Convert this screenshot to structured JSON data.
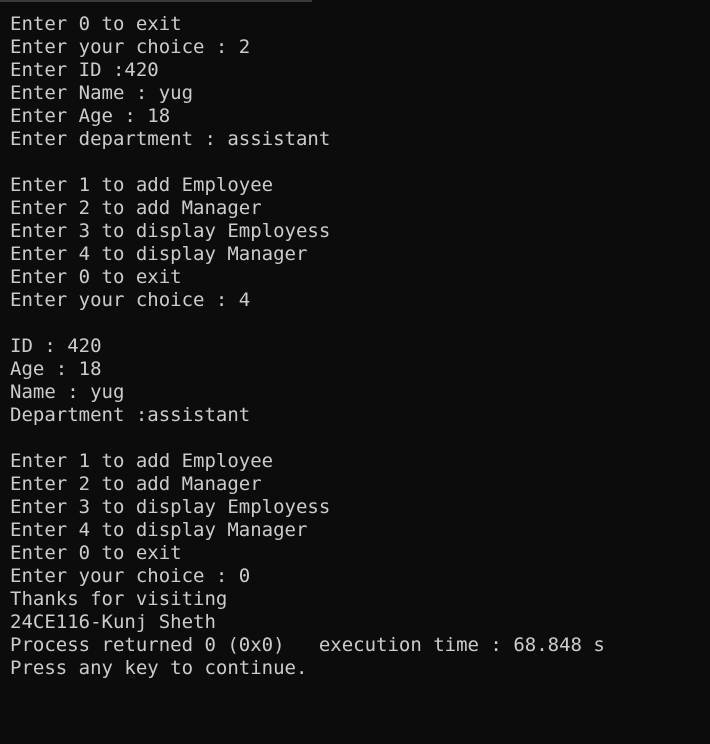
{
  "console": {
    "lines": [
      "Enter 0 to exit",
      "Enter your choice : 2",
      "Enter ID :420",
      "Enter Name : yug",
      "Enter Age : 18",
      "Enter department : assistant",
      "",
      "Enter 1 to add Employee",
      "Enter 2 to add Manager",
      "Enter 3 to display Employess",
      "Enter 4 to display Manager",
      "Enter 0 to exit",
      "Enter your choice : 4",
      "",
      "ID : 420",
      "Age : 18",
      "Name : yug",
      "Department :assistant",
      "",
      "Enter 1 to add Employee",
      "Enter 2 to add Manager",
      "Enter 3 to display Employess",
      "Enter 4 to display Manager",
      "Enter 0 to exit",
      "Enter your choice : 0",
      "Thanks for visiting",
      "24CE116-Kunj Sheth",
      "Process returned 0 (0x0)   execution time : 68.848 s",
      "Press any key to continue."
    ]
  },
  "colors": {
    "background": "#0c0c0c",
    "text": "#cccccc"
  }
}
